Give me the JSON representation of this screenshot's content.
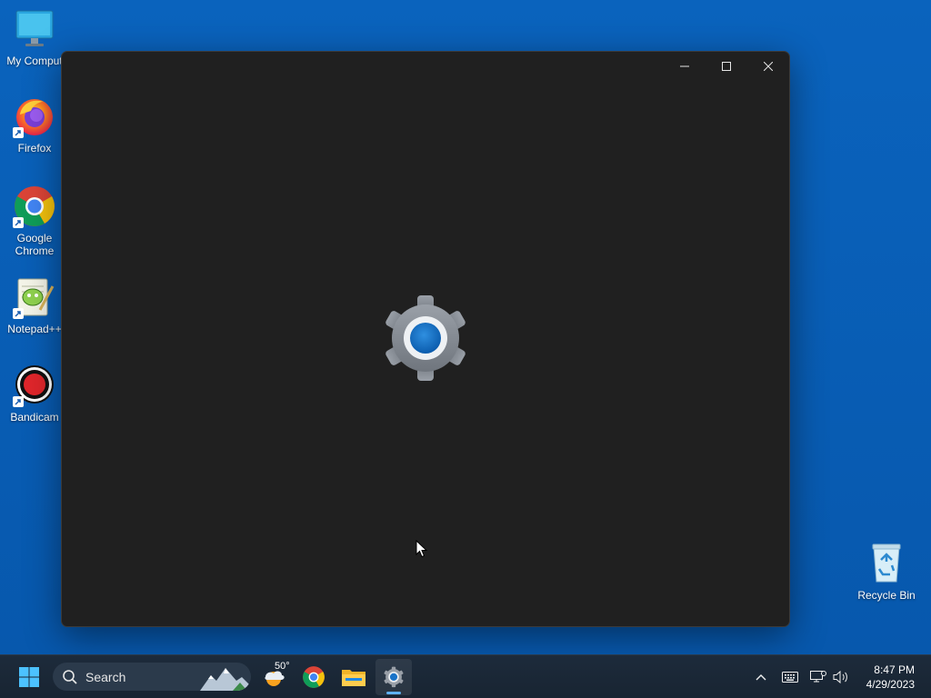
{
  "desktop": {
    "icons": [
      {
        "label": "My Comput",
        "icon": "monitor-icon"
      },
      {
        "label": "Firefox",
        "icon": "firefox-icon"
      },
      {
        "label": "Google Chrome",
        "icon": "chrome-icon"
      },
      {
        "label": "Notepad++",
        "icon": "notepadpp-icon"
      },
      {
        "label": "Bandicam",
        "icon": "bandicam-icon"
      },
      {
        "label": "Recycle Bin",
        "icon": "recycle-bin-icon"
      }
    ]
  },
  "window": {
    "app": "Settings",
    "controls": {
      "minimize": "minimize-icon",
      "maximize": "maximize-icon",
      "close": "close-icon"
    },
    "splash_icon": "settings-gear-icon"
  },
  "taskbar": {
    "search_label": "Search",
    "weather_temp": "50°",
    "pinned": [
      "start-icon",
      "weather-icon",
      "chrome-icon",
      "file-explorer-icon",
      "settings-icon"
    ],
    "clock": {
      "time": "8:47 PM",
      "date": "4/29/2023"
    }
  },
  "colors": {
    "desktop_bg": "#0a5fb4",
    "window_bg": "#202020",
    "accent": "#0f6cbd",
    "taskbar_bg": "#1c2a3a"
  }
}
